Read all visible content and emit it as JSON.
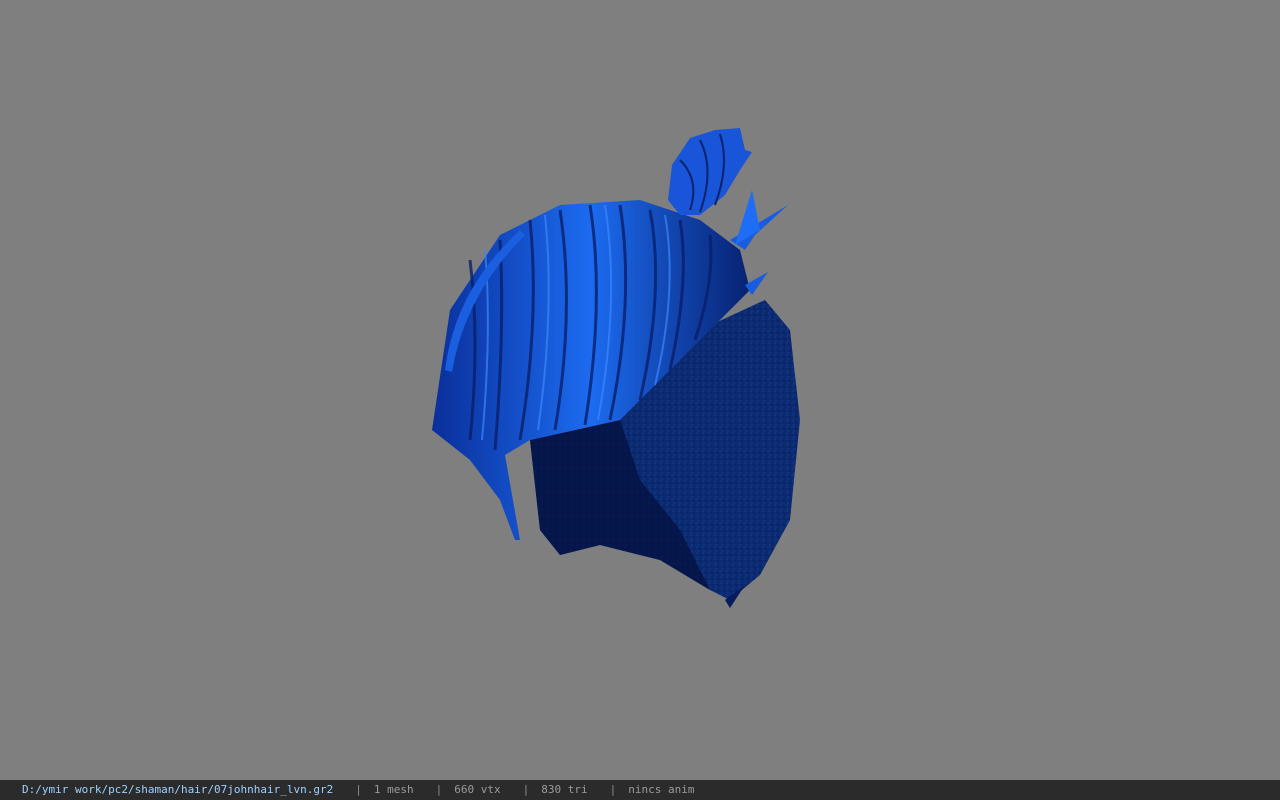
{
  "status_bar": {
    "file_path": "D:/ymir work/pc2/shaman/hair/07johnhair_lvn.gr2",
    "separator": "|",
    "mesh_count": "1 mesh",
    "vertex_count": "660 vtx",
    "triangle_count": "830 tri",
    "animation": "nincs anim"
  },
  "viewport": {
    "background_color": "#7f7f7f",
    "model_color_light": "#1f6fff",
    "model_color_dark": "#041a5a"
  }
}
